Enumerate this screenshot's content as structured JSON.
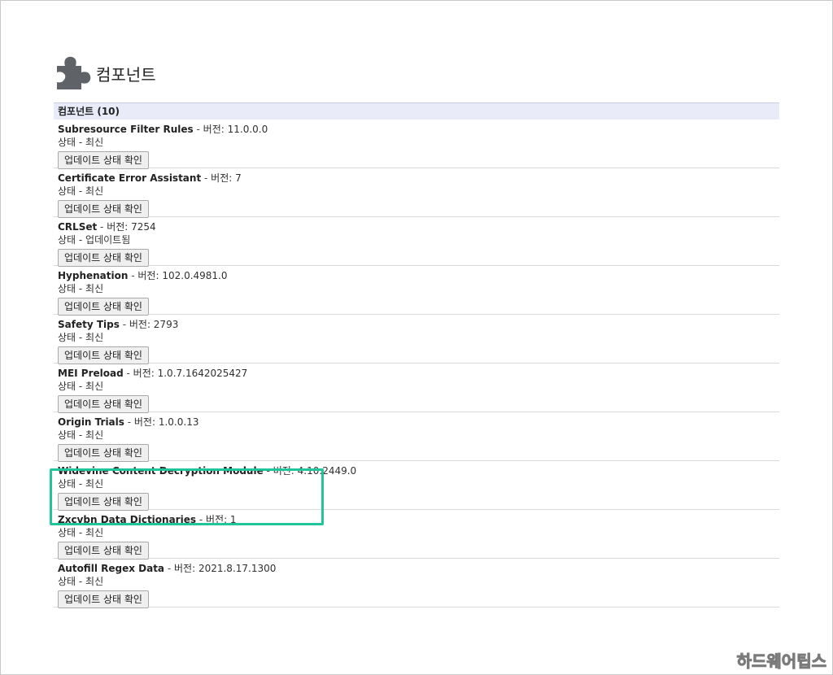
{
  "page": {
    "title": "컴포넌트"
  },
  "list": {
    "header": "컴포넌트 (10)",
    "version_label": "버전",
    "button_label": "업데이트 상태 확인",
    "items": [
      {
        "name": "Subresource Filter Rules",
        "version": "11.0.0.0",
        "status": "상태 - 최신"
      },
      {
        "name": "Certificate Error Assistant",
        "version": "7",
        "status": "상태 - 최신"
      },
      {
        "name": "CRLSet",
        "version": "7254",
        "status": "상태 - 업데이트됨"
      },
      {
        "name": "Hyphenation",
        "version": "102.0.4981.0",
        "status": "상태 - 최신"
      },
      {
        "name": "Safety Tips",
        "version": "2793",
        "status": "상태 - 최신"
      },
      {
        "name": "MEI Preload",
        "version": "1.0.7.1642025427",
        "status": "상태 - 최신"
      },
      {
        "name": "Origin Trials",
        "version": "1.0.0.13",
        "status": "상태 - 최신"
      },
      {
        "name": "Widevine Content Decryption Module",
        "version": "4.10.2449.0",
        "status": "상태 - 최신"
      },
      {
        "name": "Zxcvbn Data Dictionaries",
        "version": "1",
        "status": "상태 - 최신"
      },
      {
        "name": "Autofill Regex Data",
        "version": "2021.8.17.1300",
        "status": "상태 - 최신"
      }
    ]
  },
  "watermark": "하드웨어팁스",
  "colors": {
    "highlight": "#22c59b",
    "header_bg": "#e9ecf8"
  },
  "icons": {
    "page_icon": "puzzle-piece-icon"
  }
}
